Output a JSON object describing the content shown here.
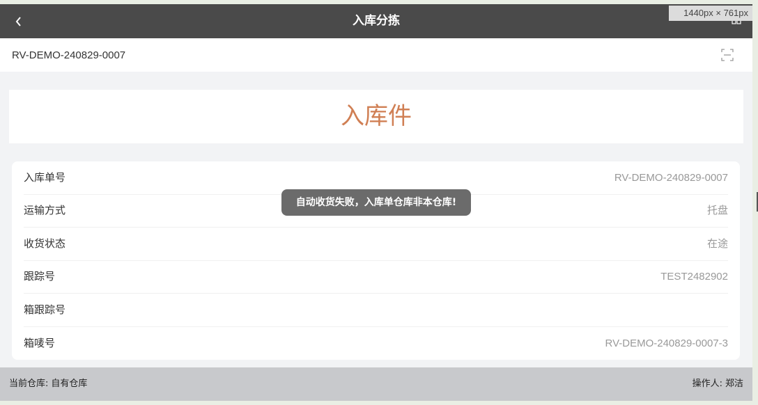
{
  "header": {
    "title": "入库分拣",
    "back_icon": "chevron-left-icon",
    "grid_icon": "grid-icon"
  },
  "dimension_badge": "1440px × 761px",
  "scan": {
    "value": "RV-DEMO-240829-0007",
    "scan_icon": "scan-icon"
  },
  "banner": {
    "title": "入库件"
  },
  "details": [
    {
      "label": "入库单号",
      "value": "RV-DEMO-240829-0007"
    },
    {
      "label": "运输方式",
      "value": "托盘"
    },
    {
      "label": "收货状态",
      "value": "在途"
    },
    {
      "label": "跟踪号",
      "value": "TEST2482902"
    },
    {
      "label": "箱跟踪号",
      "value": ""
    },
    {
      "label": "箱唛号",
      "value": "RV-DEMO-240829-0007-3"
    }
  ],
  "toast": {
    "message": "自动收货失败，入库单仓库非本仓库!"
  },
  "footer": {
    "warehouse_label": "当前仓库:",
    "warehouse_value": "自有仓库",
    "operator_label": "操作人:",
    "operator_value": "郑洁"
  },
  "colors": {
    "navbar": "#4a4a4a",
    "banner_text": "#d07f54",
    "footer": "#c8c9cc",
    "toast": "#6b6b6b"
  }
}
